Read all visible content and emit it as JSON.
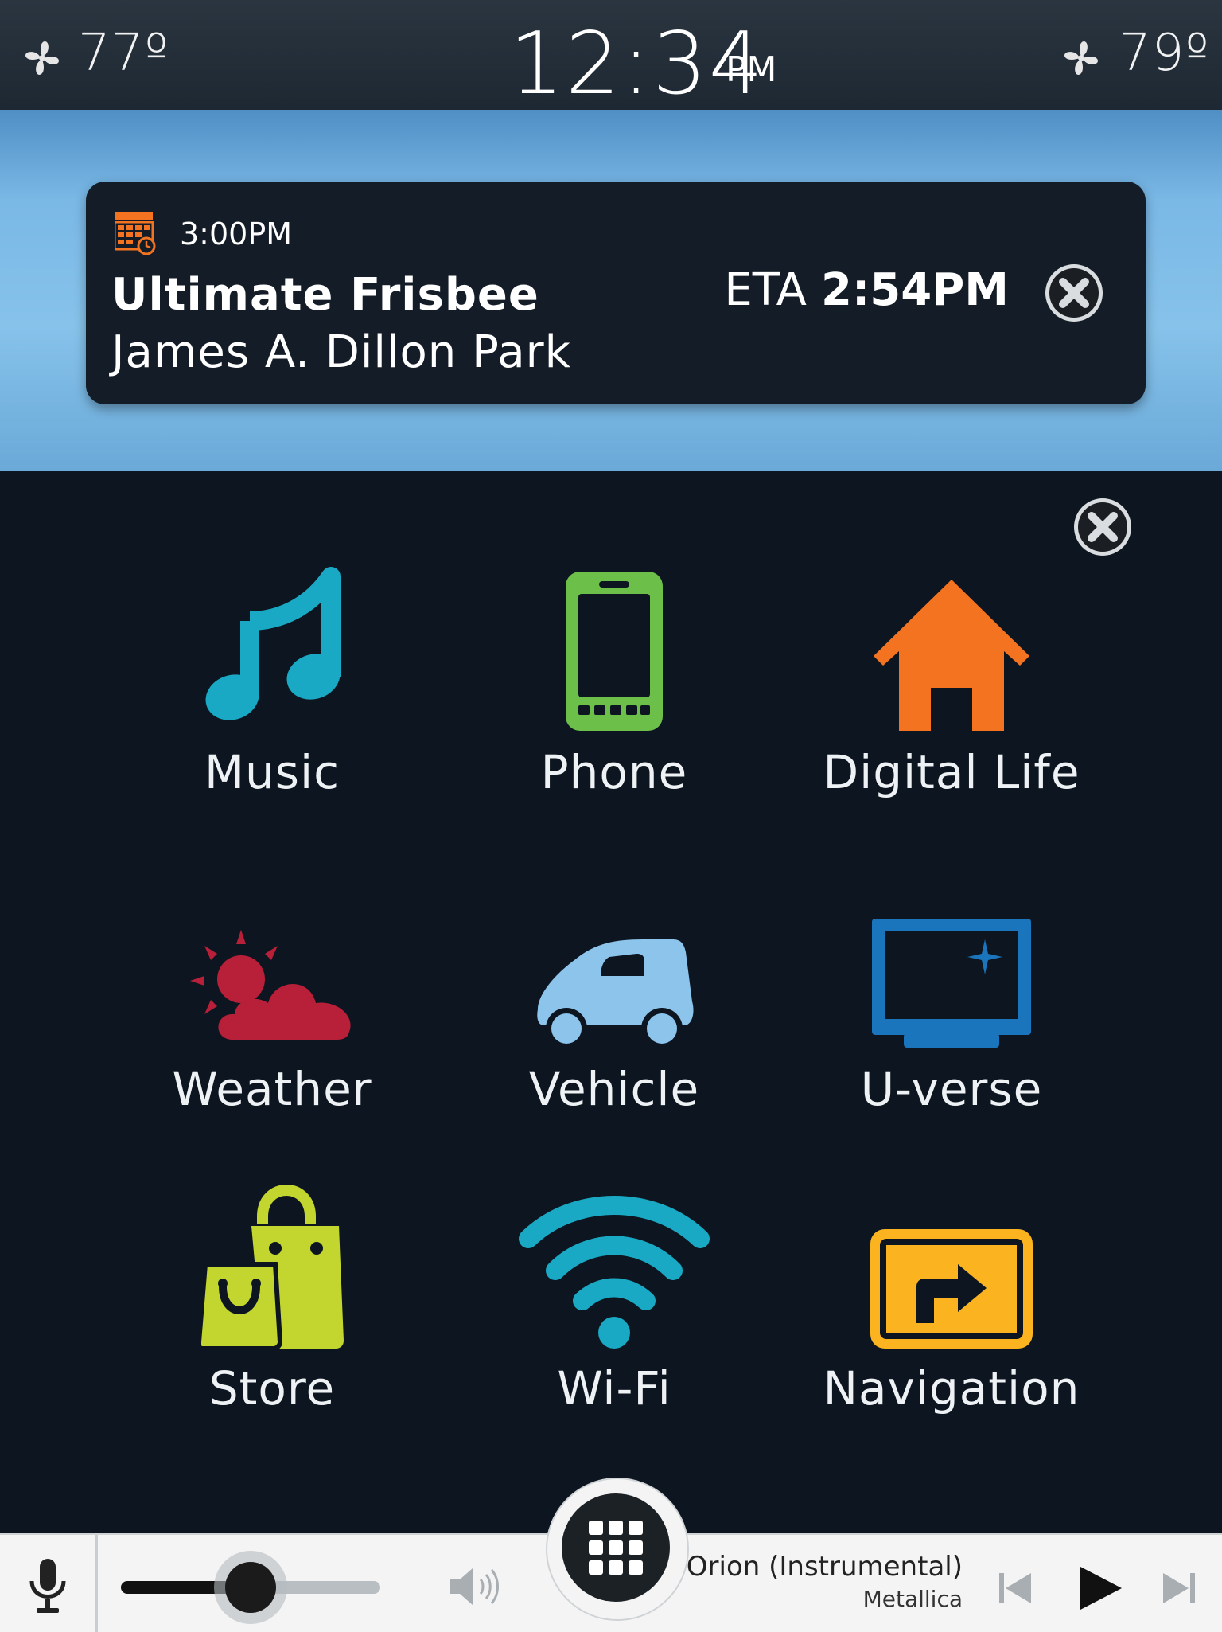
{
  "status_bar": {
    "left_temp": "77º",
    "right_temp": "79º",
    "time": "12:34",
    "ampm": "PM",
    "icons": [
      "fan-icon",
      "fan-icon"
    ]
  },
  "notification": {
    "time": "3:00PM",
    "title": "Ultimate Frisbee",
    "location": "James A. Dillon Park",
    "eta_label": "ETA",
    "eta_time": "2:54PM",
    "icons": [
      "calendar-icon",
      "close-icon"
    ]
  },
  "apps": [
    {
      "label": "Music",
      "icon": "music-note-icon",
      "color": "#19a9c4"
    },
    {
      "label": "Phone",
      "icon": "phone-icon",
      "color": "#6cc04a"
    },
    {
      "label": "Digital Life",
      "icon": "home-icon",
      "color": "#f47321"
    },
    {
      "label": "Weather",
      "icon": "sun-cloud-icon",
      "color": "#b81f39"
    },
    {
      "label": "Vehicle",
      "icon": "car-icon",
      "color": "#8cc4ec"
    },
    {
      "label": "U-verse",
      "icon": "tv-icon",
      "color": "#1a75bc"
    },
    {
      "label": "Store",
      "icon": "shopping-bags-icon",
      "color": "#c3d62f"
    },
    {
      "label": "Wi-Fi",
      "icon": "wifi-icon",
      "color": "#19a9c4"
    },
    {
      "label": "Navigation",
      "icon": "navigation-icon",
      "color": "#fbb31f"
    }
  ],
  "media_bar": {
    "song_title": "Orion (Instrumental)",
    "artist": "Metallica",
    "volume": 0.5,
    "icons": [
      "microphone-icon",
      "speaker-icon",
      "app-grid-icon",
      "previous-track-icon",
      "play-icon",
      "next-track-icon"
    ]
  }
}
